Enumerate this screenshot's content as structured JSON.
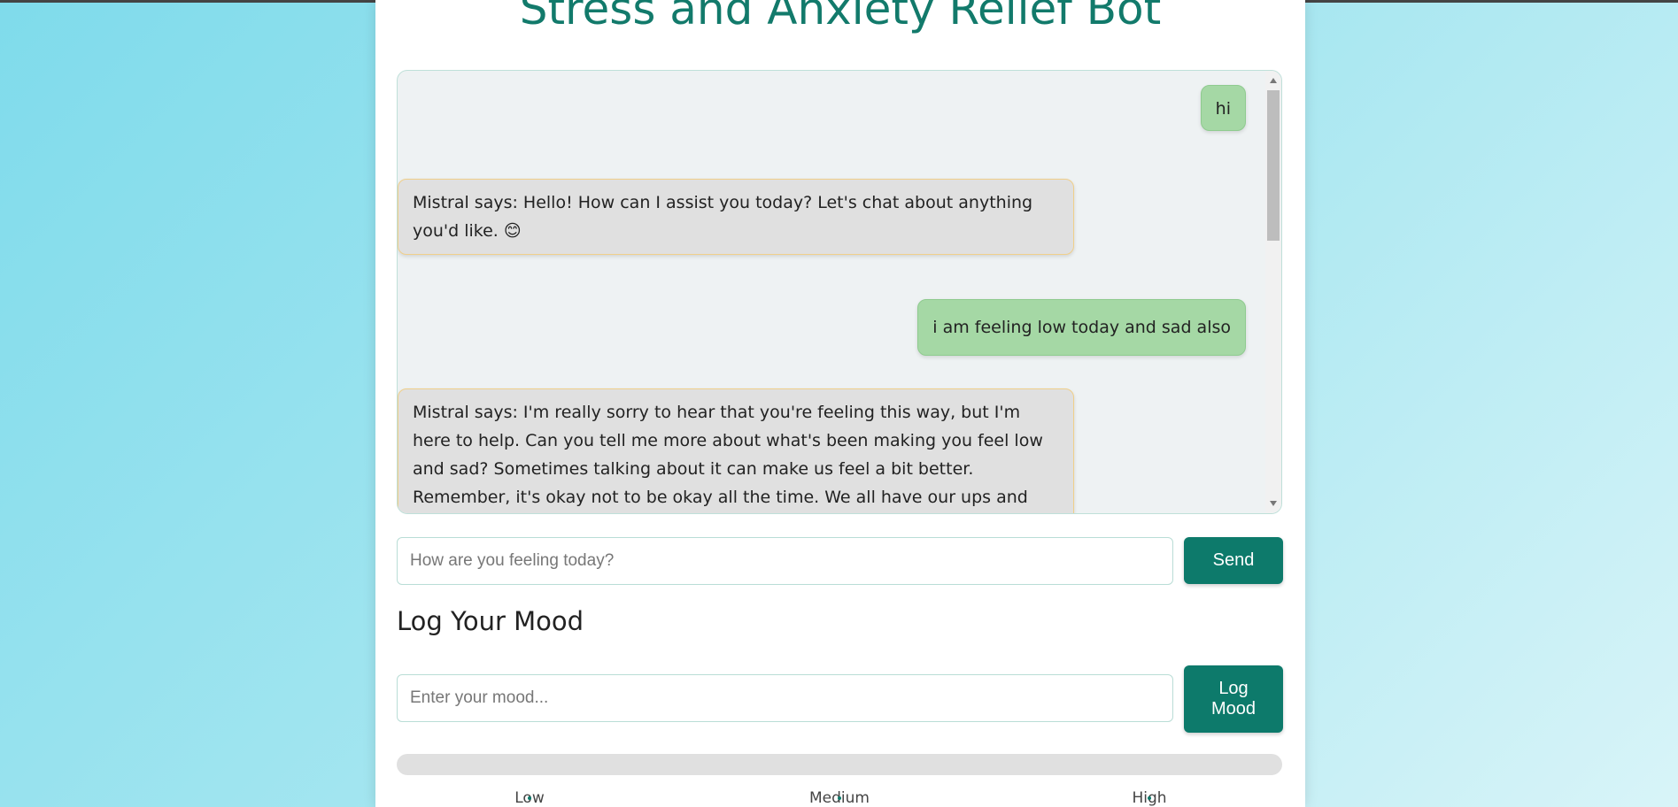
{
  "app": {
    "title": "Stress and Anxiety Relief Bot"
  },
  "chat": {
    "messages": [
      {
        "sender": "user",
        "text": "hi"
      },
      {
        "sender": "bot",
        "text": "Mistral says: Hello! How can I assist you today? Let's chat about anything you'd like. 😊"
      },
      {
        "sender": "user",
        "text": "i am feeling low today and sad also"
      },
      {
        "sender": "bot",
        "text": "Mistral says: I'm really sorry to hear that you're feeling this way, but I'm here to help. Can you tell me more about what's been making you feel low and sad? Sometimes talking about it can make us feel a bit better. Remember, it's okay not to be okay all the time. We all have our ups and downs. Here are a few things"
      }
    ],
    "input_placeholder": "How are you feeling today?",
    "send_label": "Send"
  },
  "mood": {
    "heading": "Log Your Mood",
    "input_placeholder": "Enter your mood...",
    "log_label": "Log Mood",
    "level": 0,
    "scale": [
      "Low",
      "Medium",
      "High"
    ]
  },
  "colors": {
    "accent": "#0d7a6b",
    "title": "#127a6b",
    "user_bubble": "#a5d8a5",
    "bot_bubble": "#e0e0e0",
    "bot_border": "#f0cf8a"
  }
}
